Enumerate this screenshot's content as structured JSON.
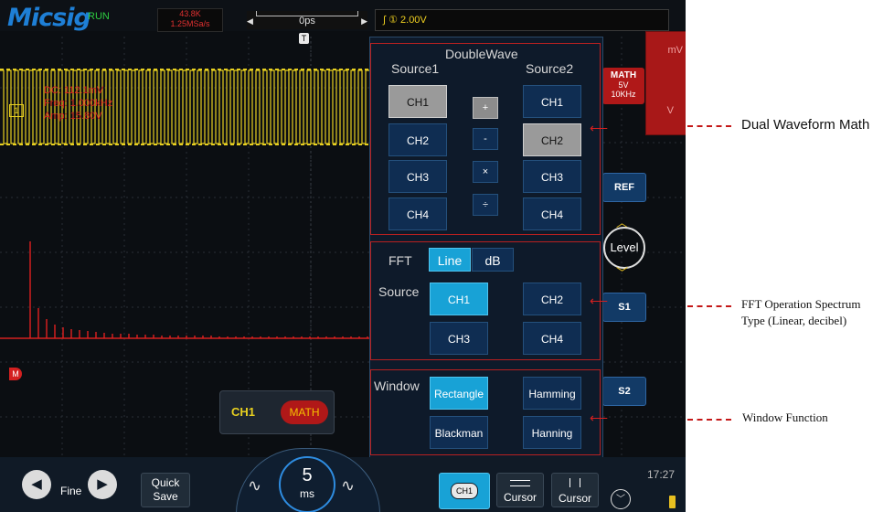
{
  "header": {
    "logo": "Micsig",
    "run_state": "RUN",
    "sample_count": "43.8K",
    "sample_rate": "1.25MSa/s",
    "time_offset": "0ps",
    "trigger_marker": "T",
    "trigger_channel": "①",
    "trigger_level": "2.00V"
  },
  "waveform": {
    "ch1_marker": "1",
    "math_marker": "M",
    "measurements": [
      "DC: 112.1mV",
      "Freq: 1.000kHz",
      "Amp: 15.80V"
    ]
  },
  "math_button": {
    "label": "MATH",
    "scale": "5V",
    "freq": "10KHz"
  },
  "right_column": {
    "unit_top": "mV",
    "unit_bottom": "V"
  },
  "side_buttons": {
    "ref": "REF",
    "level": "Level",
    "s1": "S1",
    "s2": "S2"
  },
  "dual_wave": {
    "title": "DoubleWave",
    "source1_label": "Source1",
    "source2_label": "Source2",
    "source1": [
      "CH1",
      "CH2",
      "CH3",
      "CH4"
    ],
    "source2": [
      "CH1",
      "CH2",
      "CH3",
      "CH4"
    ],
    "operators": [
      "+",
      "-",
      "×",
      "÷"
    ],
    "source1_selected": "CH1",
    "source2_selected": "CH2",
    "operator_selected": "+"
  },
  "fft": {
    "label": "FFT",
    "type_options": [
      "Line",
      "dB"
    ],
    "type_selected": "Line",
    "source_label": "Source",
    "sources": [
      "CH1",
      "CH2",
      "CH3",
      "CH4"
    ],
    "source_selected": "CH1"
  },
  "window": {
    "label": "Window",
    "options": [
      "Rectangle",
      "Hamming",
      "Blackman",
      "Hanning"
    ],
    "selected": "Rectangle"
  },
  "channel_badge": {
    "ch1": "CH1",
    "math": "MATH"
  },
  "bottom_bar": {
    "fine_label": "Fine",
    "quick_save_line1": "Quick",
    "quick_save_line2": "Save",
    "timebase_value": "5",
    "timebase_unit": "ms",
    "ch1_label": "CH1",
    "cursor1_label": "Cursor",
    "cursor2_label": "Cursor",
    "clock": "17:27"
  },
  "annotations": {
    "dual_math": "Dual Waveform Math",
    "fft_type_line1": "FFT Operation Spectrum",
    "fft_type_line2": "Type (Linear, decibel)",
    "window_function": "Window Function"
  },
  "colors": {
    "accent_red": "#d42020",
    "ch1_yellow": "#e8d020",
    "selected_cyan": "#18a2d6",
    "panel_blue": "#0f2d52"
  }
}
